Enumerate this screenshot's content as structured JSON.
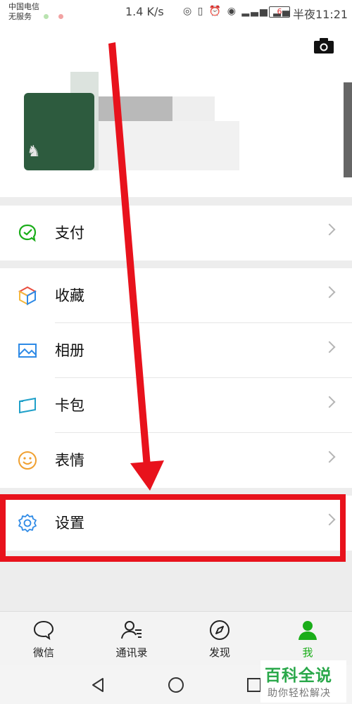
{
  "status_bar": {
    "carrier_line1": "中国电信",
    "carrier_line2": "无服务",
    "network_speed": "1.4 K/s",
    "battery_level": "6",
    "time": "半夜11:21"
  },
  "profile": {
    "camera_icon": "camera-icon"
  },
  "menu_groups": [
    [
      {
        "label": "支付",
        "icon": "pay-icon",
        "color": "#1aad19"
      }
    ],
    [
      {
        "label": "收藏",
        "icon": "favorites-cube-icon",
        "color": "#2e8ae6"
      },
      {
        "label": "相册",
        "icon": "album-icon",
        "color": "#2e8ae6"
      },
      {
        "label": "卡包",
        "icon": "card-wallet-icon",
        "color": "#1fa0c9"
      },
      {
        "label": "表情",
        "icon": "emoji-icon",
        "color": "#f0a030"
      }
    ],
    [
      {
        "label": "设置",
        "icon": "gear-icon",
        "color": "#2e8ae6"
      }
    ]
  ],
  "tab_bar": [
    {
      "label": "微信",
      "icon": "chat-icon",
      "active": false
    },
    {
      "label": "通讯录",
      "icon": "contacts-icon",
      "active": false
    },
    {
      "label": "发现",
      "icon": "discover-compass-icon",
      "active": false
    },
    {
      "label": "我",
      "icon": "me-person-icon",
      "active": true
    }
  ],
  "colors": {
    "active_tab": "#1aad19",
    "annotation_red": "#e8121c"
  },
  "watermark": {
    "title": "百科全说",
    "subtitle": "助你轻松解决"
  }
}
